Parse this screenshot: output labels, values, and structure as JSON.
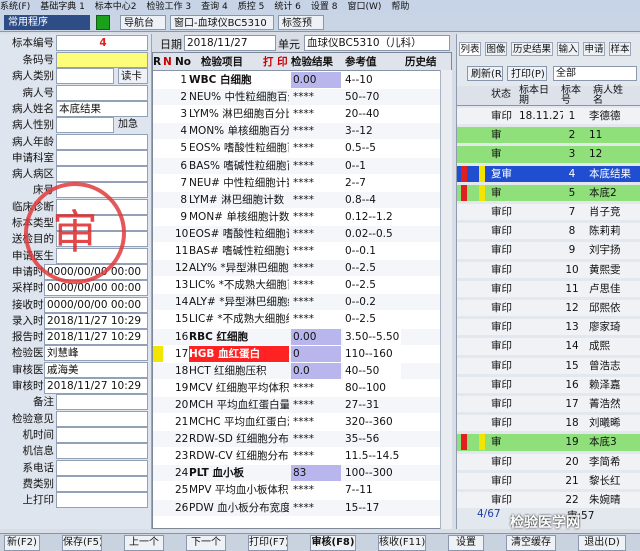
{
  "menu": [
    "系统(F)",
    "基础字典 1",
    "标本中心2",
    "检验工作 3",
    "查询 4",
    "质控 5",
    "统计 6",
    "设置 8",
    "窗口(W)",
    "帮助"
  ],
  "toolbar": {
    "common": "常用程序",
    "nav": "导航台",
    "window_tab": "窗口-血球仪BC5310",
    "label_tab": "标签预"
  },
  "left": {
    "specimen_no_label": "标本编号",
    "specimen_no": "4",
    "rows": [
      {
        "label": "条码号",
        "value": ""
      },
      {
        "label": "病人类别",
        "value": ""
      },
      {
        "label": "病人号",
        "value": ""
      },
      {
        "label": "病人姓名",
        "value": "本底结果"
      },
      {
        "label": "病人性别",
        "value": ""
      },
      {
        "label": "病人年龄",
        "value": ""
      },
      {
        "label": "申请科室",
        "value": ""
      },
      {
        "label": "病人病区",
        "value": ""
      },
      {
        "label": "床号",
        "value": ""
      },
      {
        "label": "临床诊断",
        "value": ""
      },
      {
        "label": "标本类型",
        "value": ""
      },
      {
        "label": "送检目的",
        "value": ""
      },
      {
        "label": "申请医生",
        "value": ""
      },
      {
        "label": "申请时间",
        "value": "0000/00/00 00:00"
      },
      {
        "label": "采样时间",
        "value": "0000/00/00 00:00"
      },
      {
        "label": "接收时间",
        "value": "0000/00/00 00:00"
      },
      {
        "label": "录入时间",
        "value": "2018/11/27 10:29"
      },
      {
        "label": "报告时间",
        "value": "2018/11/27 10:29"
      },
      {
        "label": "检验医生",
        "value": "刘慧峰"
      },
      {
        "label": "审核医生",
        "value": "戚海美"
      },
      {
        "label": "审核时间",
        "value": "2018/11/27 10:29"
      },
      {
        "label": "备注",
        "value": ""
      },
      {
        "label": "检验意见",
        "value": ""
      },
      {
        "label": "机时间",
        "value": ""
      },
      {
        "label": "机信息",
        "value": ""
      },
      {
        "label": "系电话",
        "value": ""
      },
      {
        "label": "费类别",
        "value": ""
      },
      {
        "label": "上打印",
        "value": ""
      }
    ],
    "read_card": "读卡",
    "add_check": "加急",
    "stamp": "审"
  },
  "datebar": {
    "date_label": "日期",
    "date": "2018/11/27",
    "unit_label": "单元",
    "unit": "血球仪BC5310（儿科）"
  },
  "grid": {
    "headers": {
      "r": "R",
      "n": "N",
      "no": "No",
      "item": "检验项目",
      "flag": "打 印",
      "result": "检验结果",
      "ref": "参考值",
      "hist": "历史结"
    },
    "rows": [
      {
        "no": "1",
        "item": "WBC 白细胞",
        "result": "0.00",
        "ref": "4--10"
      },
      {
        "no": "2",
        "item": "NEU% 中性粒细胞百分",
        "result": "****",
        "ref": "50--70"
      },
      {
        "no": "3",
        "item": "LYM% 淋巴细胞百分比",
        "result": "****",
        "ref": "20--40"
      },
      {
        "no": "4",
        "item": "MON% 单核细胞百分比",
        "result": "****",
        "ref": "3--12"
      },
      {
        "no": "5",
        "item": "EOS% 嗜酸性粒细胞百",
        "result": "****",
        "ref": "0.5--5"
      },
      {
        "no": "6",
        "item": "BAS% 嗜碱性粒细胞百",
        "result": "****",
        "ref": "0--1"
      },
      {
        "no": "7",
        "item": "NEU# 中性粒细胞计数",
        "result": "****",
        "ref": "2--7"
      },
      {
        "no": "8",
        "item": "LYM# 淋巴细胞计数",
        "result": "****",
        "ref": "0.8--4"
      },
      {
        "no": "9",
        "item": "MON# 单核细胞计数",
        "result": "****",
        "ref": "0.12--1.2"
      },
      {
        "no": "10",
        "item": "EOS# 嗜酸性粒细胞计数",
        "result": "****",
        "ref": "0.02--0.5"
      },
      {
        "no": "11",
        "item": "BAS# 嗜碱性粒细胞计",
        "result": "****",
        "ref": "0--0.1"
      },
      {
        "no": "12",
        "item": "ALY% *异型淋巴细胞百",
        "result": "****",
        "ref": "0--2.5"
      },
      {
        "no": "13",
        "item": "LIC% *不成熟大细胞百",
        "result": "****",
        "ref": "0--2.5"
      },
      {
        "no": "14",
        "item": "ALY# *异型淋巴细胞绝",
        "result": "****",
        "ref": "0--0.2"
      },
      {
        "no": "15",
        "item": "LIC# *不成熟大细胞绝",
        "result": "****",
        "ref": "0--2.5"
      },
      {
        "no": "16",
        "item": "RBC 红细胞",
        "result": "0.00",
        "ref": "3.50--5.50"
      },
      {
        "no": "17",
        "item": "HGB 血红蛋白",
        "result": "0",
        "ref": "110--160"
      },
      {
        "no": "18",
        "item": "HCT 红细胞压积",
        "result": "0.0",
        "ref": "40--50"
      },
      {
        "no": "19",
        "item": "MCV 红细胞平均体积",
        "result": "****",
        "ref": "80--100"
      },
      {
        "no": "20",
        "item": "MCH 平均血红蛋白量",
        "result": "****",
        "ref": "27--31"
      },
      {
        "no": "21",
        "item": "MCHC 平均血红蛋白浓",
        "result": "****",
        "ref": "320--360"
      },
      {
        "no": "22",
        "item": "RDW-SD 红细胞分布宽",
        "result": "****",
        "ref": "35--56"
      },
      {
        "no": "23",
        "item": "RDW-CV 红细胞分布宽",
        "result": "****",
        "ref": "11.5--14.5"
      },
      {
        "no": "24",
        "item": "PLT 血小板",
        "result": "83",
        "ref": "100--300"
      },
      {
        "no": "25",
        "item": "MPV 平均血小板体积",
        "result": "****",
        "ref": "7--11"
      },
      {
        "no": "26",
        "item": "PDW 血小板分布宽度",
        "result": "****",
        "ref": "15--17"
      }
    ]
  },
  "right": {
    "tabs": [
      "列表",
      "图像",
      "历史结果",
      "输入",
      "申请",
      "样本"
    ],
    "refresh": "刷新(R)",
    "print": "打印(P)",
    "filter": "全部",
    "headers": {
      "status": "状态",
      "date": "标本日期",
      "no": "标本号",
      "name": "病人姓名"
    },
    "rows": [
      {
        "status": "审印",
        "date": "18.11.27",
        "no": "1",
        "name": "李德德"
      },
      {
        "status": "审",
        "date": "",
        "no": "2",
        "name": "11"
      },
      {
        "status": "审",
        "date": "",
        "no": "3",
        "name": "12"
      },
      {
        "status": "复审",
        "date": "",
        "no": "4",
        "name": "本底结果"
      },
      {
        "status": "审",
        "date": "",
        "no": "5",
        "name": "本底2"
      },
      {
        "status": "审印",
        "date": "",
        "no": "7",
        "name": "肖子竞"
      },
      {
        "status": "审印",
        "date": "",
        "no": "8",
        "name": "陈莉莉"
      },
      {
        "status": "审印",
        "date": "",
        "no": "9",
        "name": "刘宇扬"
      },
      {
        "status": "审印",
        "date": "",
        "no": "10",
        "name": "黄熙雯"
      },
      {
        "status": "审印",
        "date": "",
        "no": "11",
        "name": "卢思佳"
      },
      {
        "status": "审印",
        "date": "",
        "no": "12",
        "name": "邱熙依"
      },
      {
        "status": "审印",
        "date": "",
        "no": "13",
        "name": "廖家琦"
      },
      {
        "status": "审印",
        "date": "",
        "no": "14",
        "name": "成熙"
      },
      {
        "status": "审印",
        "date": "",
        "no": "15",
        "name": "曾浩志"
      },
      {
        "status": "审印",
        "date": "",
        "no": "16",
        "name": "赖泽嘉"
      },
      {
        "status": "审印",
        "date": "",
        "no": "17",
        "name": "菁浩然"
      },
      {
        "status": "审印",
        "date": "",
        "no": "18",
        "name": "刘曦晞"
      },
      {
        "status": "审",
        "date": "",
        "no": "19",
        "name": "本底3"
      },
      {
        "status": "审印",
        "date": "",
        "no": "20",
        "name": "李简希"
      },
      {
        "status": "审印",
        "date": "",
        "no": "21",
        "name": "黎长红"
      },
      {
        "status": "审印",
        "date": "",
        "no": "22",
        "name": "朱婉晴"
      }
    ],
    "pager": "4/67",
    "footer_stat": "审:57"
  },
  "bottom": [
    "新(F2)",
    "保存(F5)",
    "上一个",
    "下一个",
    "打印(F7)",
    "审核(F8)",
    "核收(F11)",
    "设置",
    "清空缓存",
    "退出(D)"
  ],
  "watermark": "检验医学网"
}
